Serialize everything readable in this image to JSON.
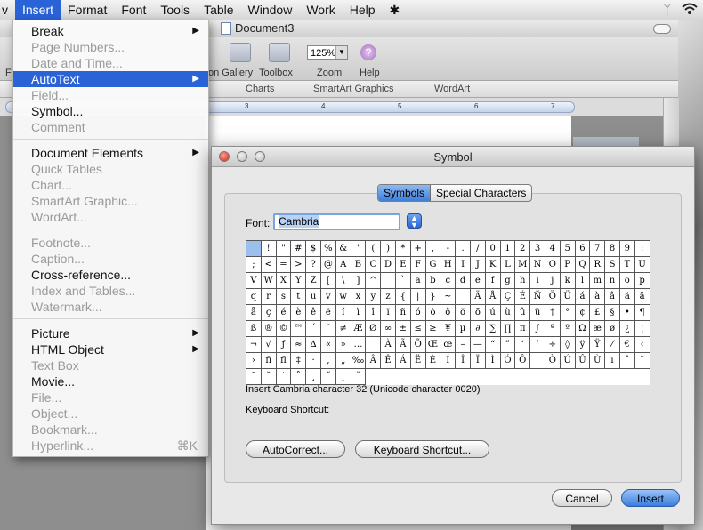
{
  "menubar": {
    "items": [
      "v",
      "Insert",
      "Format",
      "Font",
      "Tools",
      "Table",
      "Window",
      "Work",
      "Help"
    ],
    "active": "Insert"
  },
  "document": {
    "title": "Document3",
    "toolbar_labels": {
      "gallery": "on Gallery",
      "toolbox": "Toolbox",
      "zoom": "Zoom",
      "help": "Help",
      "left_f": "F"
    },
    "zoom_value": "125%",
    "ribbon_tabs": [
      "Charts",
      "SmartArt Graphics",
      "WordArt"
    ],
    "ruler_marks": [
      "3",
      "4",
      "5",
      "6",
      "7"
    ]
  },
  "insert_menu": {
    "items": [
      {
        "label": "Break",
        "enabled": true,
        "submenu": true
      },
      {
        "label": "Page Numbers...",
        "enabled": false
      },
      {
        "label": "Date and Time...",
        "enabled": false
      },
      {
        "label": "AutoText",
        "enabled": true,
        "submenu": true,
        "highlighted": true
      },
      {
        "label": "Field...",
        "enabled": false
      },
      {
        "label": "Symbol...",
        "enabled": true
      },
      {
        "label": "Comment",
        "enabled": false
      },
      {
        "label": "Document Elements",
        "enabled": true,
        "submenu": true
      },
      {
        "label": "Quick Tables",
        "enabled": false
      },
      {
        "label": "Chart...",
        "enabled": false
      },
      {
        "label": "SmartArt Graphic...",
        "enabled": false
      },
      {
        "label": "WordArt...",
        "enabled": false
      },
      {
        "label": "Footnote...",
        "enabled": false
      },
      {
        "label": "Caption...",
        "enabled": false
      },
      {
        "label": "Cross-reference...",
        "enabled": true
      },
      {
        "label": "Index and Tables...",
        "enabled": false
      },
      {
        "label": "Watermark...",
        "enabled": false
      },
      {
        "label": "Picture",
        "enabled": true,
        "submenu": true
      },
      {
        "label": "HTML Object",
        "enabled": true,
        "submenu": true
      },
      {
        "label": "Text Box",
        "enabled": false
      },
      {
        "label": "Movie...",
        "enabled": true
      },
      {
        "label": "File...",
        "enabled": false
      },
      {
        "label": "Object...",
        "enabled": false
      },
      {
        "label": "Bookmark...",
        "enabled": false
      },
      {
        "label": "Hyperlink...",
        "enabled": false,
        "shortcut": "⌘K"
      }
    ]
  },
  "symbol_dialog": {
    "title": "Symbol",
    "tabs": [
      "Symbols",
      "Special Characters"
    ],
    "font_label": "Font:",
    "font_value": "Cambria",
    "grid_rows": [
      [
        " ",
        "!",
        "\"",
        "#",
        "$",
        "%",
        "&",
        "'",
        "(",
        ")",
        "*",
        "+",
        ",",
        "-",
        ".",
        "/",
        "0",
        "1",
        "2",
        "3",
        "4",
        "5",
        "6",
        "7",
        "8",
        "9",
        ":",
        ";"
      ],
      [
        "<",
        "=",
        ">",
        "?",
        "@",
        "A",
        "B",
        "C",
        "D",
        "E",
        "F",
        "G",
        "H",
        "I",
        "J",
        "K",
        "L",
        "M",
        "N",
        "O",
        "P",
        "Q",
        "R",
        "S",
        "T",
        "U",
        "V",
        "W"
      ],
      [
        "X",
        "Y",
        "Z",
        "[",
        "\\",
        "]",
        "^",
        "_",
        "`",
        "a",
        "b",
        "c",
        "d",
        "e",
        "f",
        "g",
        "h",
        "i",
        "j",
        "k",
        "l",
        "m",
        "n",
        "o",
        "p",
        "q",
        "r",
        "s"
      ],
      [
        "t",
        "u",
        "v",
        "w",
        "x",
        "y",
        "z",
        "{",
        "|",
        "}",
        "~",
        " ",
        "Ä",
        "Å",
        "Ç",
        "É",
        "Ñ",
        "Ö",
        "Ü",
        "á",
        "à",
        "â",
        "ä",
        "ã",
        "å",
        "ç",
        "é",
        "è"
      ],
      [
        "ê",
        "ë",
        "í",
        "ì",
        "î",
        "ï",
        "ñ",
        "ó",
        "ò",
        "ô",
        "ö",
        "õ",
        "ú",
        "ù",
        "û",
        "ü",
        "†",
        "°",
        "¢",
        "£",
        "§",
        "•",
        "¶",
        "ß",
        "®",
        "©",
        "™",
        "´"
      ],
      [
        "¨",
        "≠",
        "Æ",
        "Ø",
        "∞",
        "±",
        "≤",
        "≥",
        "¥",
        "µ",
        "∂",
        "∑",
        "∏",
        "π",
        "∫",
        "ª",
        "º",
        "Ω",
        "æ",
        "ø",
        "¿",
        "¡",
        "¬",
        "√",
        "ƒ",
        "≈",
        "∆",
        "«"
      ],
      [
        "»",
        "…",
        " ",
        "À",
        "Ã",
        "Õ",
        "Œ",
        "œ",
        "–",
        "—",
        "“",
        "”",
        "‘",
        "’",
        "÷",
        "◊",
        "ÿ",
        "Ÿ",
        "⁄",
        "€",
        "‹",
        "›",
        "ﬁ",
        "ﬂ",
        "‡",
        "·",
        "‚",
        "„"
      ],
      [
        "‰",
        "Â",
        "Ê",
        "Á",
        "Ë",
        "È",
        "Í",
        "Î",
        "Ï",
        "Ì",
        "Ó",
        "Ô",
        "",
        "Ò",
        "Ú",
        "Û",
        "Ù",
        "ı",
        "ˆ",
        "˜",
        "¯",
        "˘",
        "˙",
        "˚",
        "¸",
        "˝",
        "˛",
        "ˇ"
      ]
    ],
    "info_text": "Insert Cambria character 32  (Unicode character 0020)",
    "keyboard_shortcut_label": "Keyboard Shortcut:",
    "buttons": {
      "autocorrect": "AutoCorrect...",
      "keyboard_shortcut": "Keyboard Shortcut...",
      "cancel": "Cancel",
      "insert": "Insert"
    }
  }
}
